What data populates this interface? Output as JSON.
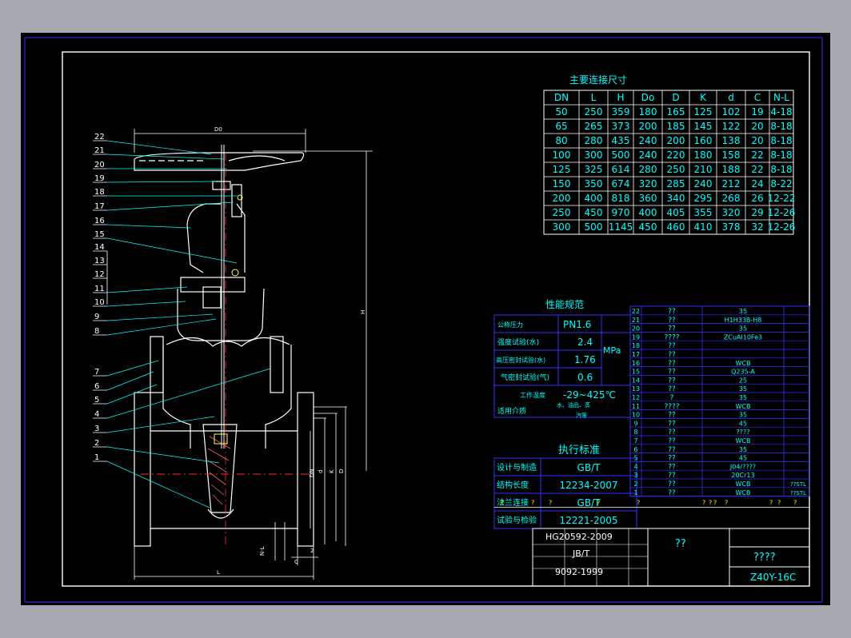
{
  "drawing": {
    "title": "Z40Y-16C",
    "title_block_name": "????",
    "title_block_center": "??",
    "standard_codes": [
      "HG20592-2009",
      "JB/T",
      "9092-1999"
    ]
  },
  "dimension_labels": {
    "do": "D0",
    "h": "H",
    "l": "L",
    "dn": "DN",
    "d_small": "d",
    "k": "K",
    "d_big": "D",
    "nl": "N-L",
    "c": "C",
    "two": "2"
  },
  "callouts": [
    "22",
    "21",
    "20",
    "19",
    "18",
    "17",
    "16",
    "15",
    "14",
    "13",
    "12",
    "11",
    "10",
    "9",
    "8",
    "7",
    "6",
    "5",
    "4",
    "3",
    "2",
    "1"
  ],
  "connection_table": {
    "title": "主要连接尺寸",
    "headers": [
      "DN",
      "L",
      "H",
      "Do",
      "D",
      "K",
      "d",
      "C",
      "N-L"
    ],
    "rows": [
      [
        "50",
        "250",
        "359",
        "180",
        "165",
        "125",
        "102",
        "19",
        "4-18"
      ],
      [
        "65",
        "265",
        "373",
        "200",
        "185",
        "145",
        "122",
        "20",
        "8-18"
      ],
      [
        "80",
        "280",
        "435",
        "240",
        "200",
        "160",
        "138",
        "20",
        "8-18"
      ],
      [
        "100",
        "300",
        "500",
        "240",
        "220",
        "180",
        "158",
        "22",
        "8-18"
      ],
      [
        "125",
        "325",
        "614",
        "280",
        "250",
        "210",
        "188",
        "22",
        "8-18"
      ],
      [
        "150",
        "350",
        "674",
        "320",
        "285",
        "240",
        "212",
        "24",
        "8-22"
      ],
      [
        "200",
        "400",
        "818",
        "360",
        "340",
        "295",
        "268",
        "26",
        "12-22"
      ],
      [
        "250",
        "450",
        "970",
        "400",
        "405",
        "355",
        "320",
        "29",
        "12-26"
      ],
      [
        "300",
        "500",
        "1145",
        "450",
        "460",
        "410",
        "378",
        "32",
        "12-26"
      ]
    ]
  },
  "performance": {
    "title": "性能规范",
    "nominal_label": "公称压力",
    "nominal_value": "PN1.6",
    "unit": "MPa",
    "strength_label": "强度试验(水)",
    "strength_value": "2.4",
    "seal_water_label": "高压密封试验(水)",
    "seal_water_value": "1.76",
    "seal_gas_label": "气密封试验(气)",
    "seal_gas_value": "0.6",
    "temp_label": "工作温度",
    "temp_value": "-29~425℃",
    "medium_label": "适用介质",
    "medium_value_1": "水、油品、蒸",
    "medium_value_2": "汽等"
  },
  "standards": {
    "title": "执行标准",
    "rows": [
      {
        "label": "设计与制造",
        "value": "GB/T"
      },
      {
        "label": "结构长度",
        "value": "12234-2007"
      },
      {
        "label": "法兰连接",
        "value": "GB/T"
      },
      {
        "label": "试验与检验",
        "value": "12221-2005"
      }
    ]
  },
  "parts_list": [
    {
      "no": "22",
      "name": "??",
      "mat": "35"
    },
    {
      "no": "21",
      "name": "??",
      "mat": "H1H33B-H8"
    },
    {
      "no": "20",
      "name": "??",
      "mat": "35"
    },
    {
      "no": "19",
      "name": "????",
      "mat": "ZCuAl10Fe3"
    },
    {
      "no": "18",
      "name": "??",
      "mat": ""
    },
    {
      "no": "17",
      "name": "??",
      "mat": ""
    },
    {
      "no": "16",
      "name": "??",
      "mat": "WCB"
    },
    {
      "no": "15",
      "name": "??",
      "mat": "Q235-A"
    },
    {
      "no": "14",
      "name": "??",
      "mat": "25"
    },
    {
      "no": "13",
      "name": "??",
      "mat": "35"
    },
    {
      "no": "12",
      "name": "?",
      "mat": "35"
    },
    {
      "no": "11",
      "name": "????",
      "mat": "WCB"
    },
    {
      "no": "10",
      "name": "??",
      "mat": "35"
    },
    {
      "no": "9",
      "name": "??",
      "mat": "45"
    },
    {
      "no": "8",
      "name": "??",
      "mat": "????"
    },
    {
      "no": "7",
      "name": "??",
      "mat": "WCB"
    },
    {
      "no": "6",
      "name": "??",
      "mat": "35"
    },
    {
      "no": "5",
      "name": "??",
      "mat": "45"
    },
    {
      "no": "4",
      "name": "??",
      "mat": "J04/????"
    },
    {
      "no": "3",
      "name": "??",
      "mat": "20Cr13"
    },
    {
      "no": "2",
      "name": "??",
      "mat": "WCB"
    },
    {
      "no": "1",
      "name": "??",
      "mat": "WCB"
    }
  ],
  "parts_extra": {
    "row2_tail": "??STL",
    "row1_tail": "??STL"
  },
  "colors": {
    "frame": "#ffffff",
    "table": "#0000ff",
    "text": "#00ffff",
    "cyan": "#00ffff",
    "yellow": "#ffff00",
    "red": "#ff0000"
  }
}
